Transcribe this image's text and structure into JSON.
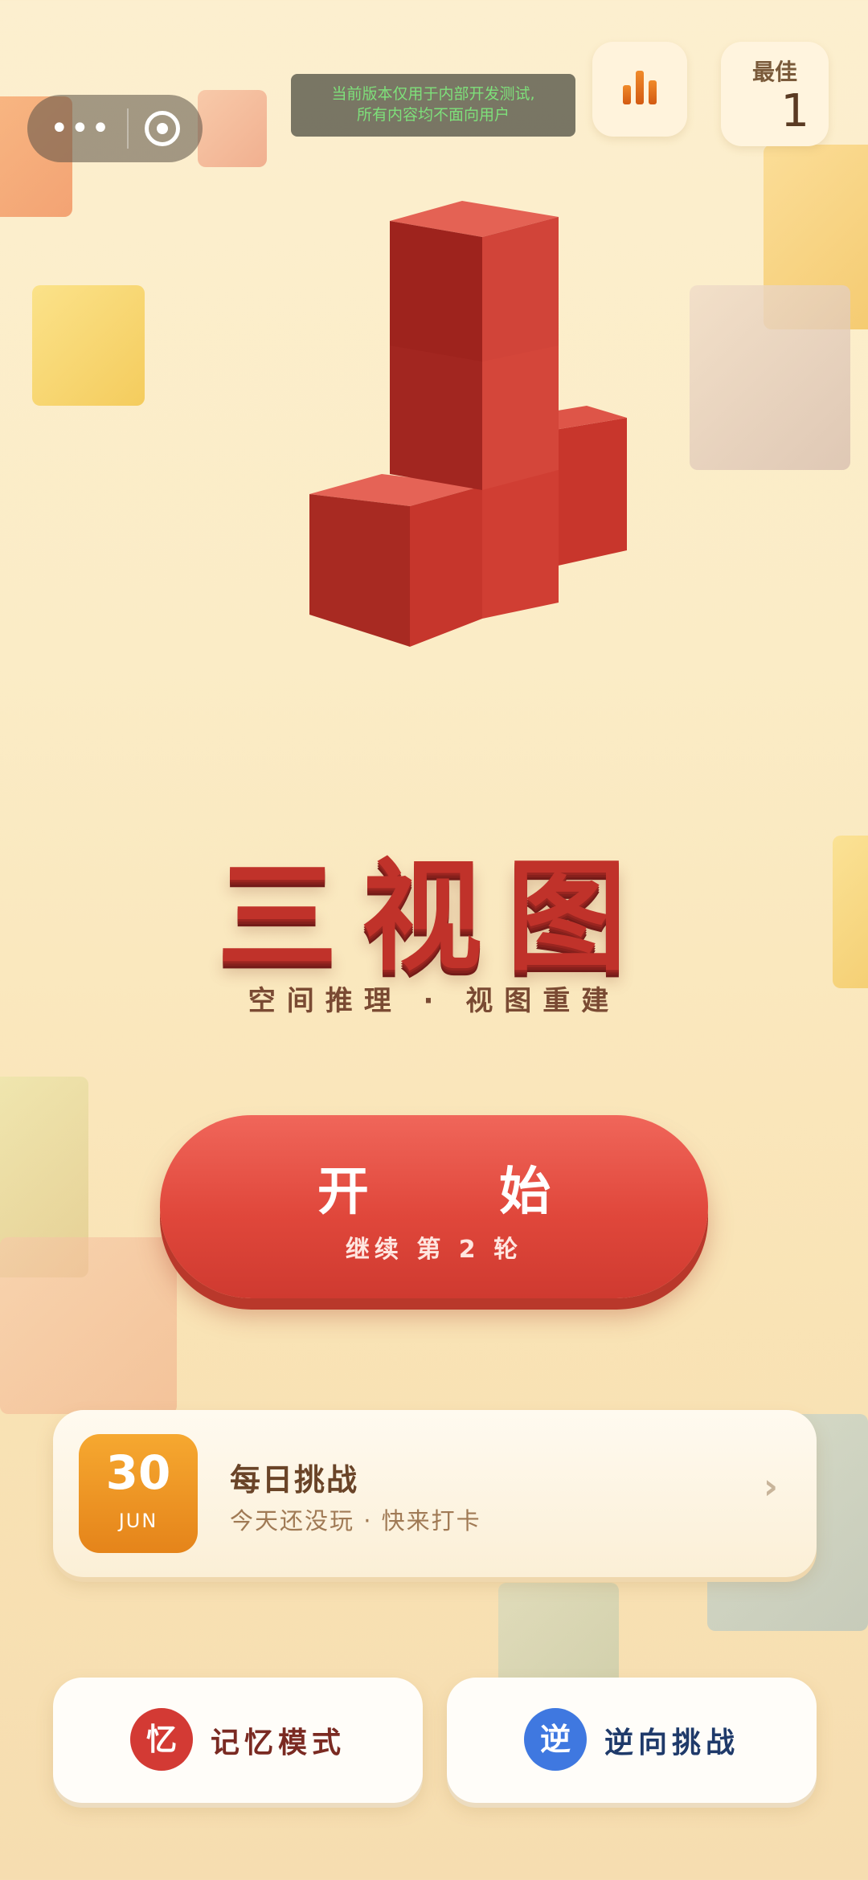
{
  "topbar": {
    "menu_icon": "more-dots-icon",
    "close_icon": "target-circle-icon",
    "notice_line1": "当前版本仅用于内部开发测试,",
    "notice_line2": "所有内容均不面向用户",
    "stats_icon": "bar-chart-icon",
    "best_label": "最佳",
    "best_value": "1"
  },
  "hero": {
    "title": "三视图",
    "subtitle": "空间推理 · 视图重建"
  },
  "start_button": {
    "label": "开 始",
    "sublabel": "继续 第 2 轮"
  },
  "daily_challenge": {
    "day": "30",
    "month": "JUN",
    "title": "每日挑战",
    "status": "今天还没玩 · 快来打卡",
    "chevron_icon": "chevron-right-icon"
  },
  "modes": [
    {
      "icon_text": "忆",
      "label": "记忆模式",
      "color": "#d33a34"
    },
    {
      "icon_text": "逆",
      "label": "逆向挑战",
      "color": "#3f78e0"
    }
  ],
  "colors": {
    "accent": "#e0473b",
    "cube_red": "#c0322a",
    "daily_orange": "#f0962a"
  }
}
